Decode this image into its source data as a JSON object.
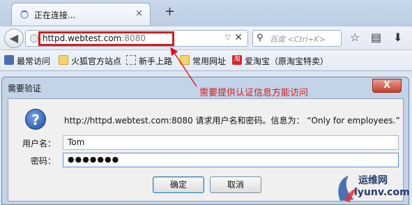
{
  "tab": {
    "title": "正在连接...",
    "close_icon": "×",
    "new_tab_icon": "+"
  },
  "navbar": {
    "url_host": "httpd.webtest.com",
    "url_port": ":8080",
    "search_placeholder": "百度 <Ctrl+K>",
    "url_clear_icon": "✕",
    "url_dropdown_icon": "▽"
  },
  "bookmarks": [
    {
      "label": "最常访问",
      "icon": "folder-icon"
    },
    {
      "label": "火狐官方站点",
      "icon": "folder-icon"
    },
    {
      "label": "新手上路",
      "icon": "dashed-box-icon"
    },
    {
      "label": "常用网址",
      "icon": "folder-icon"
    },
    {
      "label": "爱淘宝（原淘宝特卖）",
      "icon": "taobao-icon",
      "icon_text": "淘"
    }
  ],
  "annotation": {
    "text": "需要提供认证信息方能访问",
    "color": "#e01414"
  },
  "dialog": {
    "title": "需要验证",
    "close_label": "X",
    "prompt": "http://httpd.webtest.com:8080 请求用户名和密码。信息为：  “Only for employees.”",
    "username_label": "用户名：",
    "username_value": "Tom",
    "password_label": "密码：",
    "password_value": "●●●●●●●",
    "ok_label": "确定",
    "cancel_label": "取消"
  },
  "watermark": {
    "text_cn": "运维网",
    "text_en": "iyunv.com"
  },
  "colors": {
    "accent_red": "#d81b1b",
    "dialog_frame": "#c3d4e9",
    "close_button": "#c7412b"
  }
}
